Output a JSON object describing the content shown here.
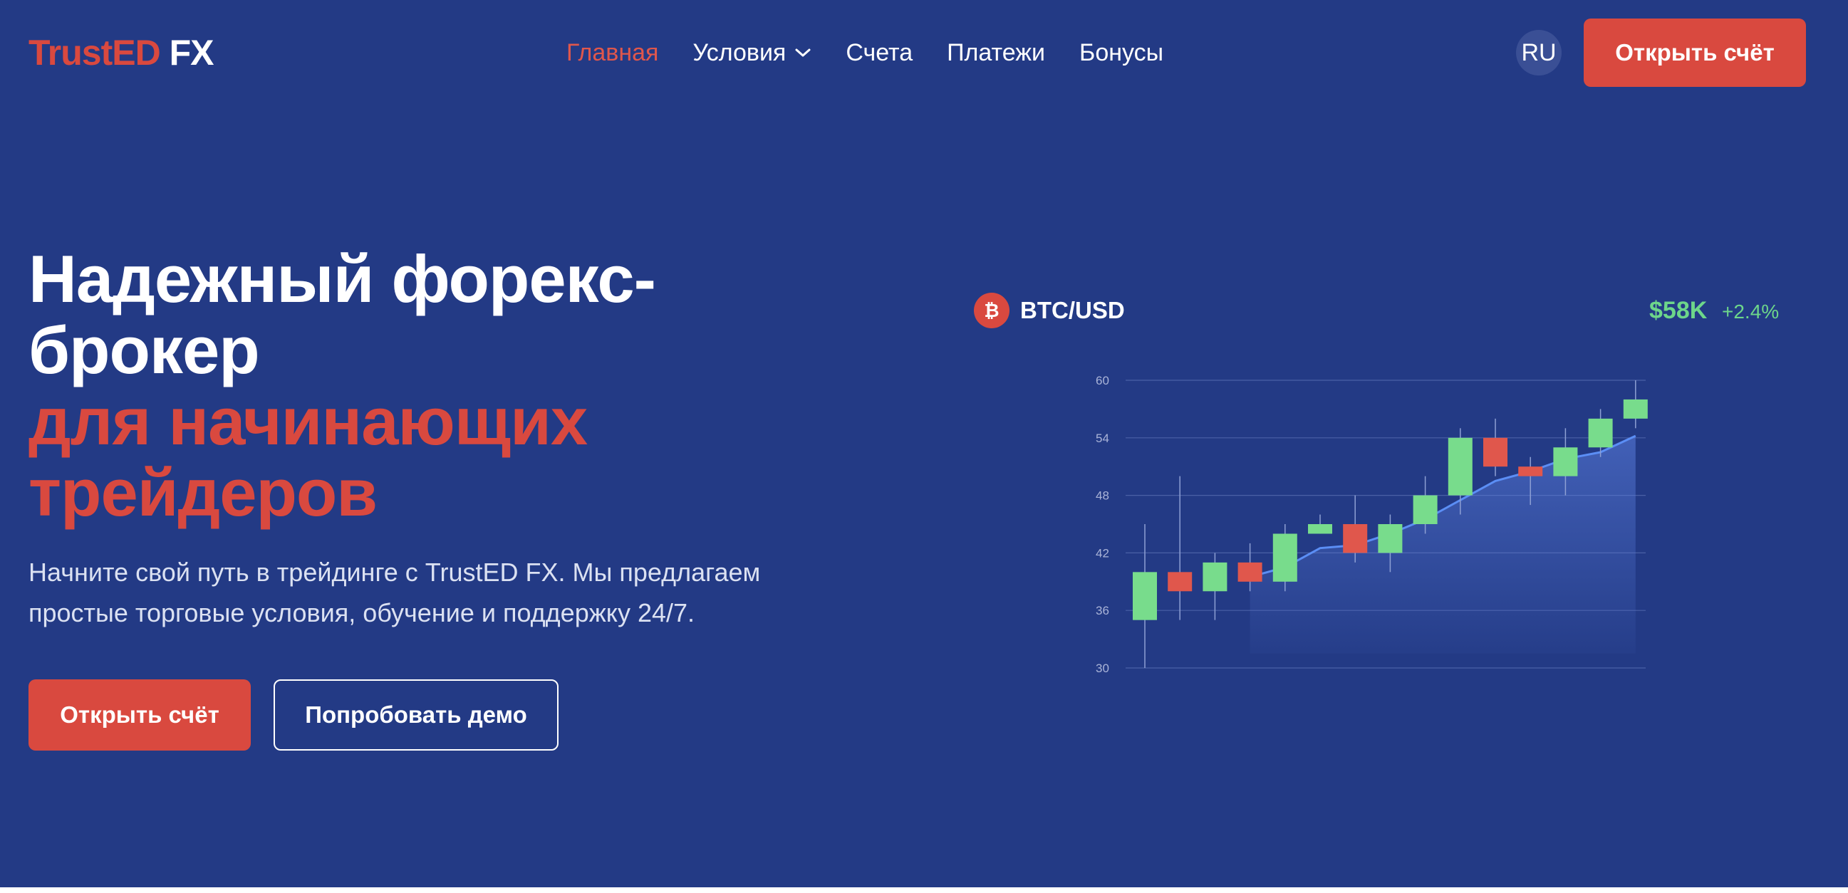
{
  "header": {
    "logo_part1": "TrustED",
    "logo_part2": "FX",
    "nav": [
      {
        "label": "Главная",
        "active": true
      },
      {
        "label": "Условия",
        "has_dropdown": true
      },
      {
        "label": "Счета"
      },
      {
        "label": "Платежи"
      },
      {
        "label": "Бонусы"
      }
    ],
    "lang": "RU",
    "cta": "Открыть счёт"
  },
  "hero": {
    "title_line1": "Надежный форекс-",
    "title_line2": "брокер",
    "title_accent1": "для начинающих",
    "title_accent2": "трейдеров",
    "lead": "Начните свой путь в трейдинге с TrustED FX. Мы предлагаем простые торговые условия, обучение и поддержку 24/7.",
    "primary_button": "Открыть счёт",
    "secondary_button": "Попробовать демо"
  },
  "ticker": {
    "coin_symbol": "₿",
    "pair": "BTC/USD",
    "price": "$58K",
    "change": "+2.4%"
  },
  "colors": {
    "background": "#233a85",
    "accent": "#d9493f",
    "up": "#78dc8c",
    "down": "#e0574c",
    "ma_line": "#5b8ef5"
  },
  "chart_data": {
    "type": "candlestick",
    "y_ticks": [
      "60",
      "54",
      "48",
      "42",
      "36",
      "30"
    ],
    "ylim": [
      30,
      60
    ],
    "grid": true,
    "candles": [
      {
        "open": 35,
        "close": 40,
        "high": 45,
        "low": 30
      },
      {
        "open": 40,
        "close": 38,
        "high": 50,
        "low": 35
      },
      {
        "open": 38,
        "close": 41,
        "high": 42,
        "low": 35
      },
      {
        "open": 41,
        "close": 39,
        "high": 43,
        "low": 38
      },
      {
        "open": 39,
        "close": 44,
        "high": 45,
        "low": 38
      },
      {
        "open": 44,
        "close": 45,
        "high": 46,
        "low": 44
      },
      {
        "open": 45,
        "close": 42,
        "high": 48,
        "low": 41
      },
      {
        "open": 42,
        "close": 45,
        "high": 46,
        "low": 40
      },
      {
        "open": 45,
        "close": 48,
        "high": 50,
        "low": 44
      },
      {
        "open": 48,
        "close": 54,
        "high": 55,
        "low": 46
      },
      {
        "open": 54,
        "close": 51,
        "high": 56,
        "low": 50
      },
      {
        "open": 51,
        "close": 50,
        "high": 52,
        "low": 47
      },
      {
        "open": 50,
        "close": 53,
        "high": 55,
        "low": 48
      },
      {
        "open": 53,
        "close": 56,
        "high": 57,
        "low": 52
      },
      {
        "open": 56,
        "close": 58,
        "high": 60,
        "low": 55
      }
    ],
    "moving_average": [
      39.5,
      40.5,
      42.5,
      42.8,
      44.0,
      45.5,
      47.5,
      49.5,
      50.5,
      51.8,
      52.5,
      54.2
    ]
  }
}
